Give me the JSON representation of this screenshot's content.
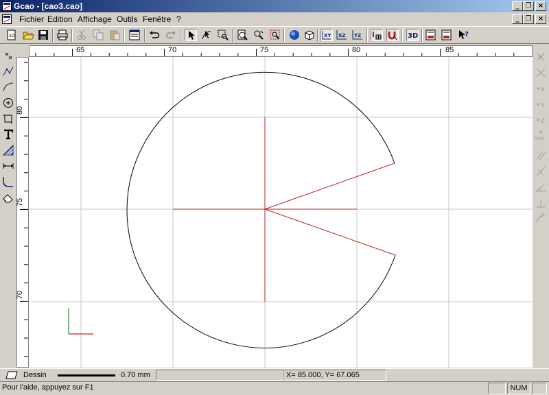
{
  "window": {
    "title": "Gcao - [cao3.cao]",
    "minimize_glyph": "_",
    "restore_glyph": "❐",
    "close_glyph": "×"
  },
  "menu": [
    "Fichier",
    "Edition",
    "Affichage",
    "Outils",
    "Fenêtre",
    "?"
  ],
  "toolbar": {
    "buttons": [
      "new-file-icon",
      "open-folder-icon",
      "save-icon",
      "print-icon",
      "cut-icon",
      "copy-icon",
      "paste-icon",
      "properties-icon",
      "undo-icon",
      "redo-icon",
      "select-arrow-icon",
      "node-edit-icon",
      "zoom-window-icon",
      "zoom-icon",
      "zoom-dynamic-icon",
      "zoom-all-icon",
      "render-sphere-icon",
      "view-3d-box-icon",
      "plane-xy-icon",
      "plane-xz-icon",
      "plane-yz-icon",
      "grid-snap-icon",
      "magnet-snap-icon",
      "view-3d-icon",
      "print-preview-icon",
      "print-3d-icon",
      "help-pointer-icon"
    ],
    "labels": {
      "xy": "XY",
      "xz": "XZ",
      "yz": "YZ",
      "view3d": "3D"
    }
  },
  "left_tools": [
    "point-icon",
    "polyline-icon",
    "curve-icon",
    "circle-icon",
    "rectangle-icon",
    "text-icon",
    "hatch-icon",
    "dimension-icon",
    "fillet-icon",
    "erase-icon"
  ],
  "right_tools": [
    "snap-point-icon",
    "snap-intersection-icon",
    "snap-x-icon",
    "snap-y-icon",
    "snap-z-icon",
    "snap-nom-icon",
    "snap-parallel-icon",
    "snap-perpendicular-icon",
    "snap-angle-icon",
    "snap-orthogonal-icon",
    "snap-tangent-icon"
  ],
  "right_tool_labels": {
    "x": "X",
    "y": "Y",
    "z": "Z",
    "nom": "NOM"
  },
  "ruler": {
    "h_labels": [
      "65",
      "70",
      "75",
      "80",
      "85"
    ],
    "v_labels": [
      "80",
      "75",
      "70"
    ]
  },
  "status": {
    "layer": "Dessin",
    "line_width": "0.70 mm",
    "coords": "X=   85.000, Y=    67.065",
    "help": "Pour l'aide, appuyez sur F1",
    "num": "NUM"
  },
  "colors": {
    "title_start": "#0a246a",
    "title_end": "#a6caf0",
    "construction_line": "#b22222",
    "shape_line": "#000000",
    "grid": "#c8c8c8",
    "axis_y": "#2e8b2e",
    "axis_x": "#cc2222"
  }
}
